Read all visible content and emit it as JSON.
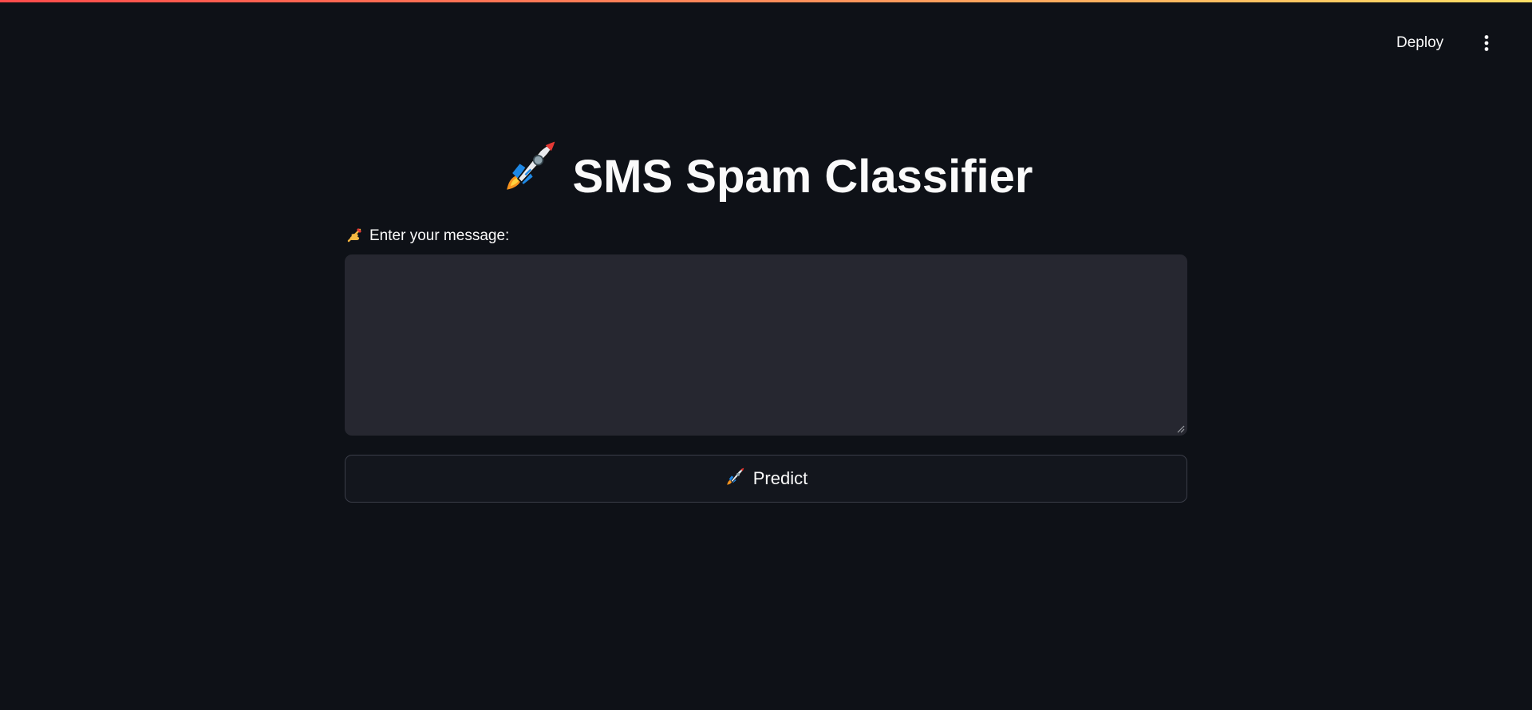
{
  "header": {
    "deploy_label": "Deploy",
    "menu_icon": "more-vertical-icon"
  },
  "main": {
    "title": "SMS Spam Classifier",
    "title_icon": "rocket-icon",
    "input_label": "Enter your message:",
    "input_label_icon": "writing-hand-icon",
    "input_value": "",
    "predict_button_label": "Predict",
    "predict_button_icon": "rocket-icon"
  },
  "colors": {
    "background": "#0e1117",
    "input_background": "#262730",
    "text": "#fafafa",
    "accent_gradient_start": "#ff4b4b",
    "accent_gradient_end": "#ffe066"
  }
}
